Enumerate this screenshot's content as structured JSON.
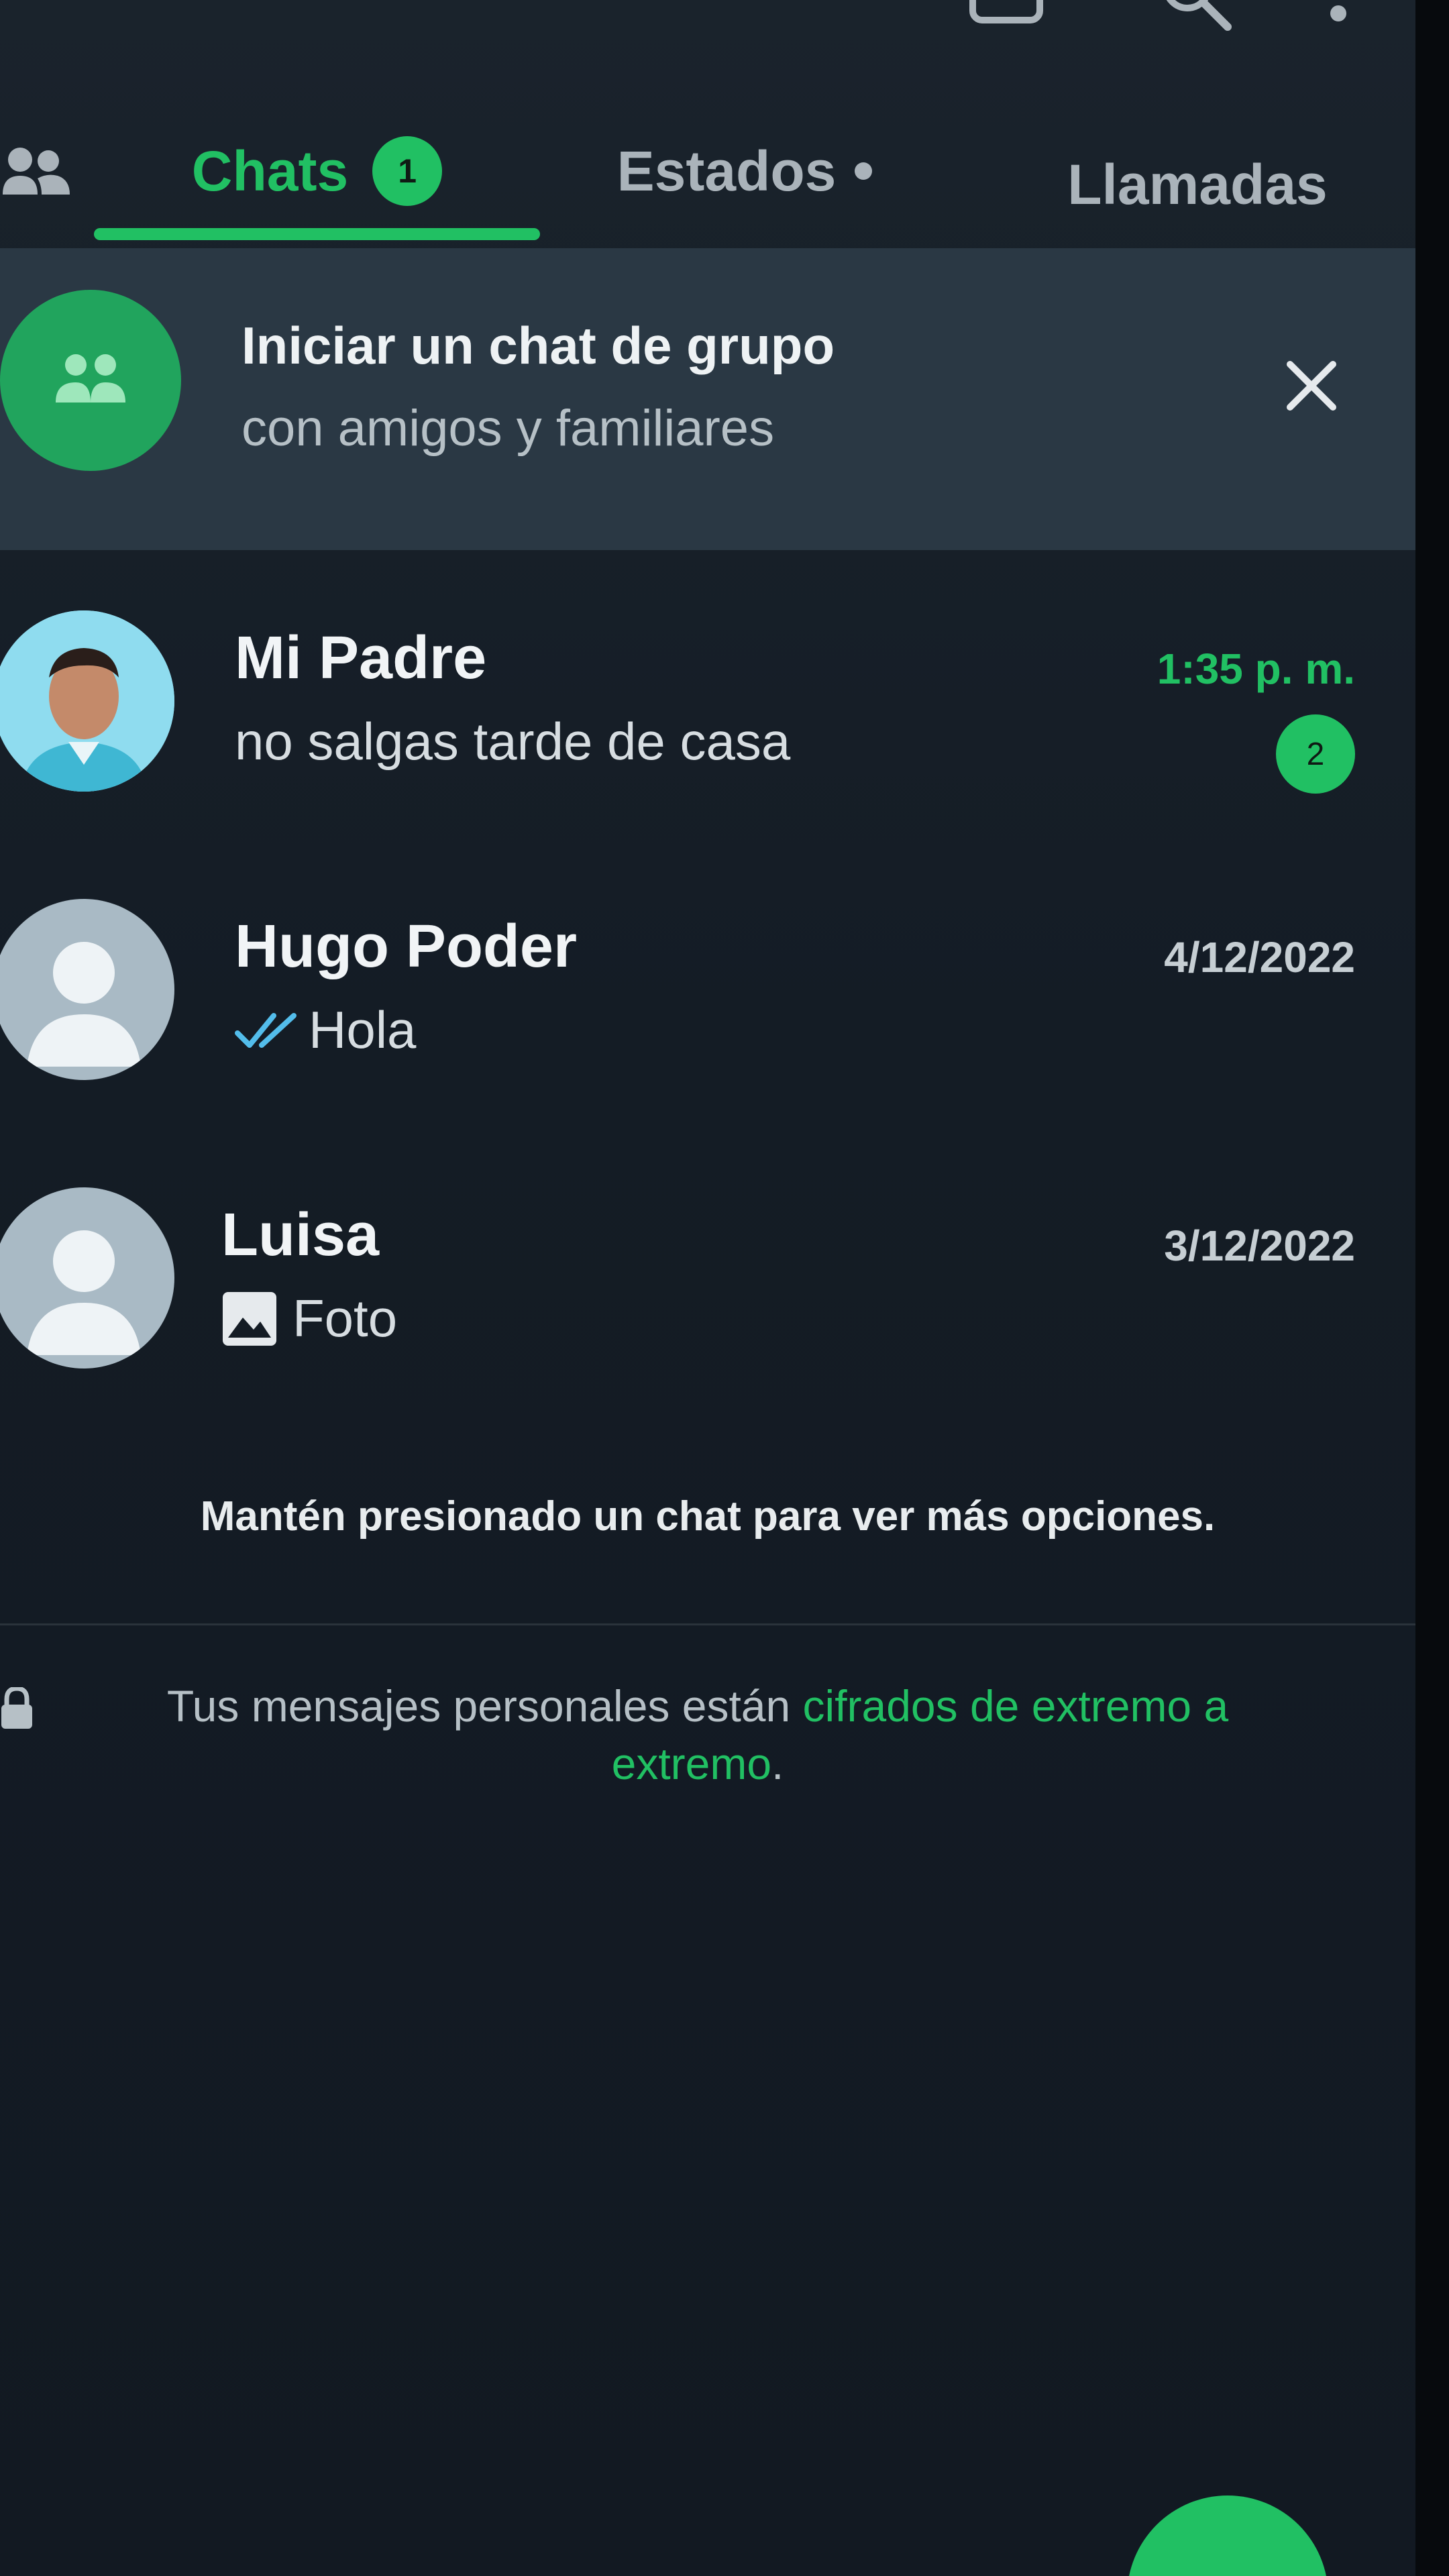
{
  "tabs": {
    "community_icon": "community-icon",
    "chats_label": "Chats",
    "chats_badge": "1",
    "estados_label": "Estados",
    "llamadas_label": "Llamadas"
  },
  "banner": {
    "title": "Iniciar un chat de grupo",
    "subtitle": "con amigos y familiares",
    "icon": "group-icon",
    "close_icon": "close-icon"
  },
  "chats": [
    {
      "name": "Mi Padre",
      "message": "no salgas tarde de casa",
      "time": "1:35 p. m.",
      "unread": "2",
      "avatar": "photo"
    },
    {
      "name": "Hugo Poder",
      "message": "Hola",
      "time": "4/12/2022",
      "status_icon": "double-check-icon",
      "avatar": "default"
    },
    {
      "name": "Luisa",
      "message": "Foto",
      "time": "3/12/2022",
      "status_icon": "photo-icon",
      "avatar": "default"
    }
  ],
  "hint": "Mantén presionado un chat para ver más opciones.",
  "encryption": {
    "prefix": "Tus mensajes personales están ",
    "link": "cifrados de extremo a extremo",
    "suffix": "."
  },
  "colors": {
    "accent": "#21c063",
    "background": "#141c25",
    "banner": "#2a3844"
  }
}
